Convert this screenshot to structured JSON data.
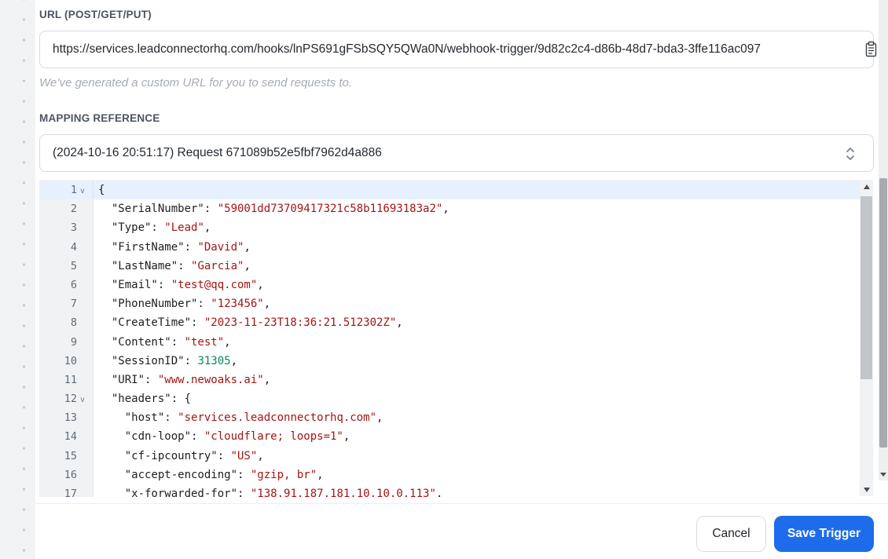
{
  "url_section": {
    "label": "URL (POST/GET/PUT)",
    "value": "https://services.leadconnectorhq.com/hooks/lnPS691gFSbSQY5QWa0N/webhook-trigger/9d82c2c4-d86b-48d7-bda3-3ffe116ac097",
    "helper": "We’ve generated a custom URL for you to send requests to."
  },
  "mapping_section": {
    "label": "MAPPING REFERENCE",
    "selected_option": "(2024-10-16 20:51:17) Request 671089b52e5fbf7962d4a886"
  },
  "editor": {
    "lines": [
      {
        "n": "1",
        "fold": true,
        "active": true,
        "parts": [
          [
            "p",
            "{"
          ]
        ]
      },
      {
        "n": "2",
        "fold": false,
        "active": false,
        "parts": [
          [
            "p",
            "  \"SerialNumber\": "
          ],
          [
            "s",
            "\"59001dd73709417321c58b11693183a2\""
          ],
          [
            "p",
            ","
          ]
        ]
      },
      {
        "n": "3",
        "fold": false,
        "active": false,
        "parts": [
          [
            "p",
            "  \"Type\": "
          ],
          [
            "s",
            "\"Lead\""
          ],
          [
            "p",
            ","
          ]
        ]
      },
      {
        "n": "4",
        "fold": false,
        "active": false,
        "parts": [
          [
            "p",
            "  \"FirstName\": "
          ],
          [
            "s",
            "\"David\""
          ],
          [
            "p",
            ","
          ]
        ]
      },
      {
        "n": "5",
        "fold": false,
        "active": false,
        "parts": [
          [
            "p",
            "  \"LastName\": "
          ],
          [
            "s",
            "\"Garcia\""
          ],
          [
            "p",
            ","
          ]
        ]
      },
      {
        "n": "6",
        "fold": false,
        "active": false,
        "parts": [
          [
            "p",
            "  \"Email\": "
          ],
          [
            "s",
            "\"test@qq.com\""
          ],
          [
            "p",
            ","
          ]
        ]
      },
      {
        "n": "7",
        "fold": false,
        "active": false,
        "parts": [
          [
            "p",
            "  \"PhoneNumber\": "
          ],
          [
            "s",
            "\"123456\""
          ],
          [
            "p",
            ","
          ]
        ]
      },
      {
        "n": "8",
        "fold": false,
        "active": false,
        "parts": [
          [
            "p",
            "  \"CreateTime\": "
          ],
          [
            "s",
            "\"2023-11-23T18:36:21.512302Z\""
          ],
          [
            "p",
            ","
          ]
        ]
      },
      {
        "n": "9",
        "fold": false,
        "active": false,
        "parts": [
          [
            "p",
            "  \"Content\": "
          ],
          [
            "s",
            "\"test\""
          ],
          [
            "p",
            ","
          ]
        ]
      },
      {
        "n": "10",
        "fold": false,
        "active": false,
        "parts": [
          [
            "p",
            "  \"SessionID\": "
          ],
          [
            "n",
            "31305"
          ],
          [
            "p",
            ","
          ]
        ]
      },
      {
        "n": "11",
        "fold": false,
        "active": false,
        "parts": [
          [
            "p",
            "  \"URI\": "
          ],
          [
            "s",
            "\"www.newoaks.ai\""
          ],
          [
            "p",
            ","
          ]
        ]
      },
      {
        "n": "12",
        "fold": true,
        "active": false,
        "parts": [
          [
            "p",
            "  \"headers\": {"
          ]
        ]
      },
      {
        "n": "13",
        "fold": false,
        "active": false,
        "parts": [
          [
            "p",
            "    \"host\": "
          ],
          [
            "s",
            "\"services.leadconnectorhq.com\""
          ],
          [
            "p",
            ","
          ]
        ]
      },
      {
        "n": "14",
        "fold": false,
        "active": false,
        "parts": [
          [
            "p",
            "    \"cdn-loop\": "
          ],
          [
            "s",
            "\"cloudflare; loops=1\""
          ],
          [
            "p",
            ","
          ]
        ]
      },
      {
        "n": "15",
        "fold": false,
        "active": false,
        "parts": [
          [
            "p",
            "    \"cf-ipcountry\": "
          ],
          [
            "s",
            "\"US\""
          ],
          [
            "p",
            ","
          ]
        ]
      },
      {
        "n": "16",
        "fold": false,
        "active": false,
        "parts": [
          [
            "p",
            "    \"accept-encoding\": "
          ],
          [
            "s",
            "\"gzip, br\""
          ],
          [
            "p",
            ","
          ]
        ]
      },
      {
        "n": "17",
        "fold": false,
        "active": false,
        "parts": [
          [
            "p",
            "    \"x-forwarded-for\": "
          ],
          [
            "s",
            "\"138.91.187.181,10.10.0.113\""
          ],
          [
            "p",
            ","
          ]
        ]
      }
    ]
  },
  "footer": {
    "cancel_label": "Cancel",
    "save_label": "Save Trigger"
  },
  "colors": {
    "accent_blue": "#1e6ceb",
    "string_token": "#a31515",
    "number_token": "#098658",
    "active_line_bg": "#e7f1fd"
  }
}
